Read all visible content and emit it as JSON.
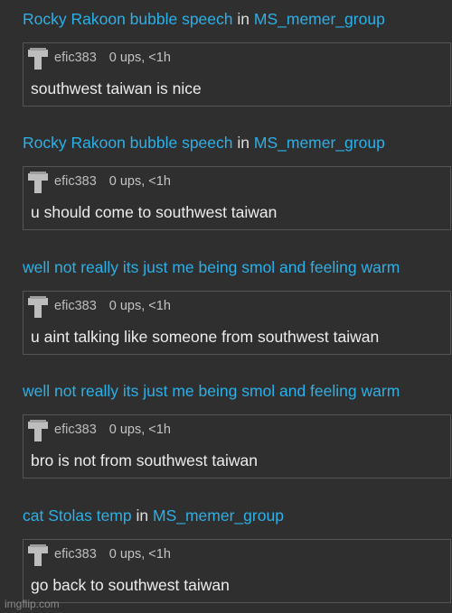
{
  "entries": [
    {
      "title": "Rocky Rakoon bubble speech",
      "in_word": "in",
      "group": "MS_memer_group",
      "username": "efic383",
      "stats": "0 ups, <1h",
      "text": "southwest taiwan is nice"
    },
    {
      "title": "Rocky Rakoon bubble speech",
      "in_word": "in",
      "group": "MS_memer_group",
      "username": "efic383",
      "stats": "0 ups, <1h",
      "text": "u should come to southwest taiwan"
    },
    {
      "title": "well not really its just me being smol and feeling warm",
      "in_word": "",
      "group": "",
      "username": "efic383",
      "stats": "0 ups, <1h",
      "text": "u aint talking like someone from southwest taiwan"
    },
    {
      "title": "well not really its just me being smol and feeling warm",
      "in_word": "",
      "group": "",
      "username": "efic383",
      "stats": "0 ups, <1h",
      "text": "bro is not from southwest taiwan"
    },
    {
      "title": "cat Stolas temp",
      "in_word": "in",
      "group": "MS_memer_group",
      "username": "efic383",
      "stats": "0 ups, <1h",
      "text": "go back to southwest taiwan"
    }
  ],
  "avatar_icon": "default-user-avatar-icon",
  "watermark": "imgflip.com",
  "colors": {
    "background": "#2f2f2f",
    "link": "#2bb0e8",
    "border": "#555555",
    "text": "#ececec",
    "meta": "#c4c4c4"
  }
}
